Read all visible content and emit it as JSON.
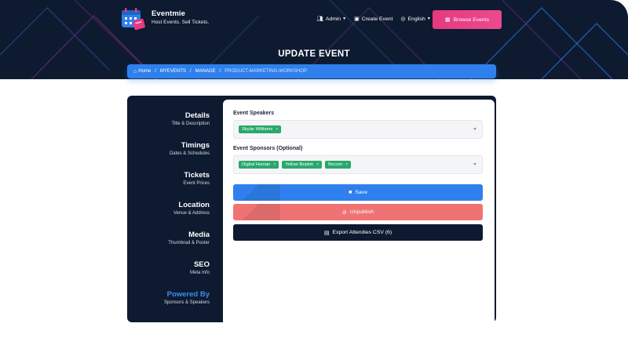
{
  "brand": {
    "name": "Eventmie",
    "tagline": "Host Events. Sell Tickets."
  },
  "nav": {
    "admin": "Admin",
    "create_event": "Create Event",
    "language": "English",
    "browse": "Browse Events"
  },
  "page": {
    "title": "UPDATE EVENT"
  },
  "breadcrumb": {
    "home": "Home",
    "myevents": "MYEVENTS",
    "manage": "MANAGE",
    "current": "PRODUCT-MARKETING-WORKSHOP"
  },
  "sidebar": {
    "items": [
      {
        "title": "Details",
        "sub": "Title & Description"
      },
      {
        "title": "Timings",
        "sub": "Dates & Schedules"
      },
      {
        "title": "Tickets",
        "sub": "Event Prices"
      },
      {
        "title": "Location",
        "sub": "Venue & Address"
      },
      {
        "title": "Media",
        "sub": "Thumbnail & Poster"
      },
      {
        "title": "SEO",
        "sub": "Meta Info"
      },
      {
        "title": "Powered By",
        "sub": "Sponsors & Speakers"
      }
    ],
    "active_index": 6
  },
  "form": {
    "speakers_label": "Event Speakers",
    "speakers": [
      "Skylar Williams"
    ],
    "sponsors_label": "Event Sponsors (Optional)",
    "sponsors": [
      "Digital Human",
      "Yellow Bepink",
      "Becom"
    ],
    "chip_remove": "×",
    "save_label": "Save",
    "unpublish_label": "Unpublish",
    "export_label": "Export Attendies CSV (6)"
  },
  "colors": {
    "navy": "#0d1a30",
    "primary": "#2f80ed",
    "pink": "#e83e8c",
    "danger": "#f07373",
    "chip": "#2aa86b"
  },
  "icons": {
    "admin": "users-icon",
    "create": "calendar-plus-icon",
    "language": "globe-icon",
    "browse": "calendar-icon",
    "home": "home-icon",
    "save": "save-icon",
    "unpublish": "eye-slash-icon",
    "export": "file-icon"
  }
}
